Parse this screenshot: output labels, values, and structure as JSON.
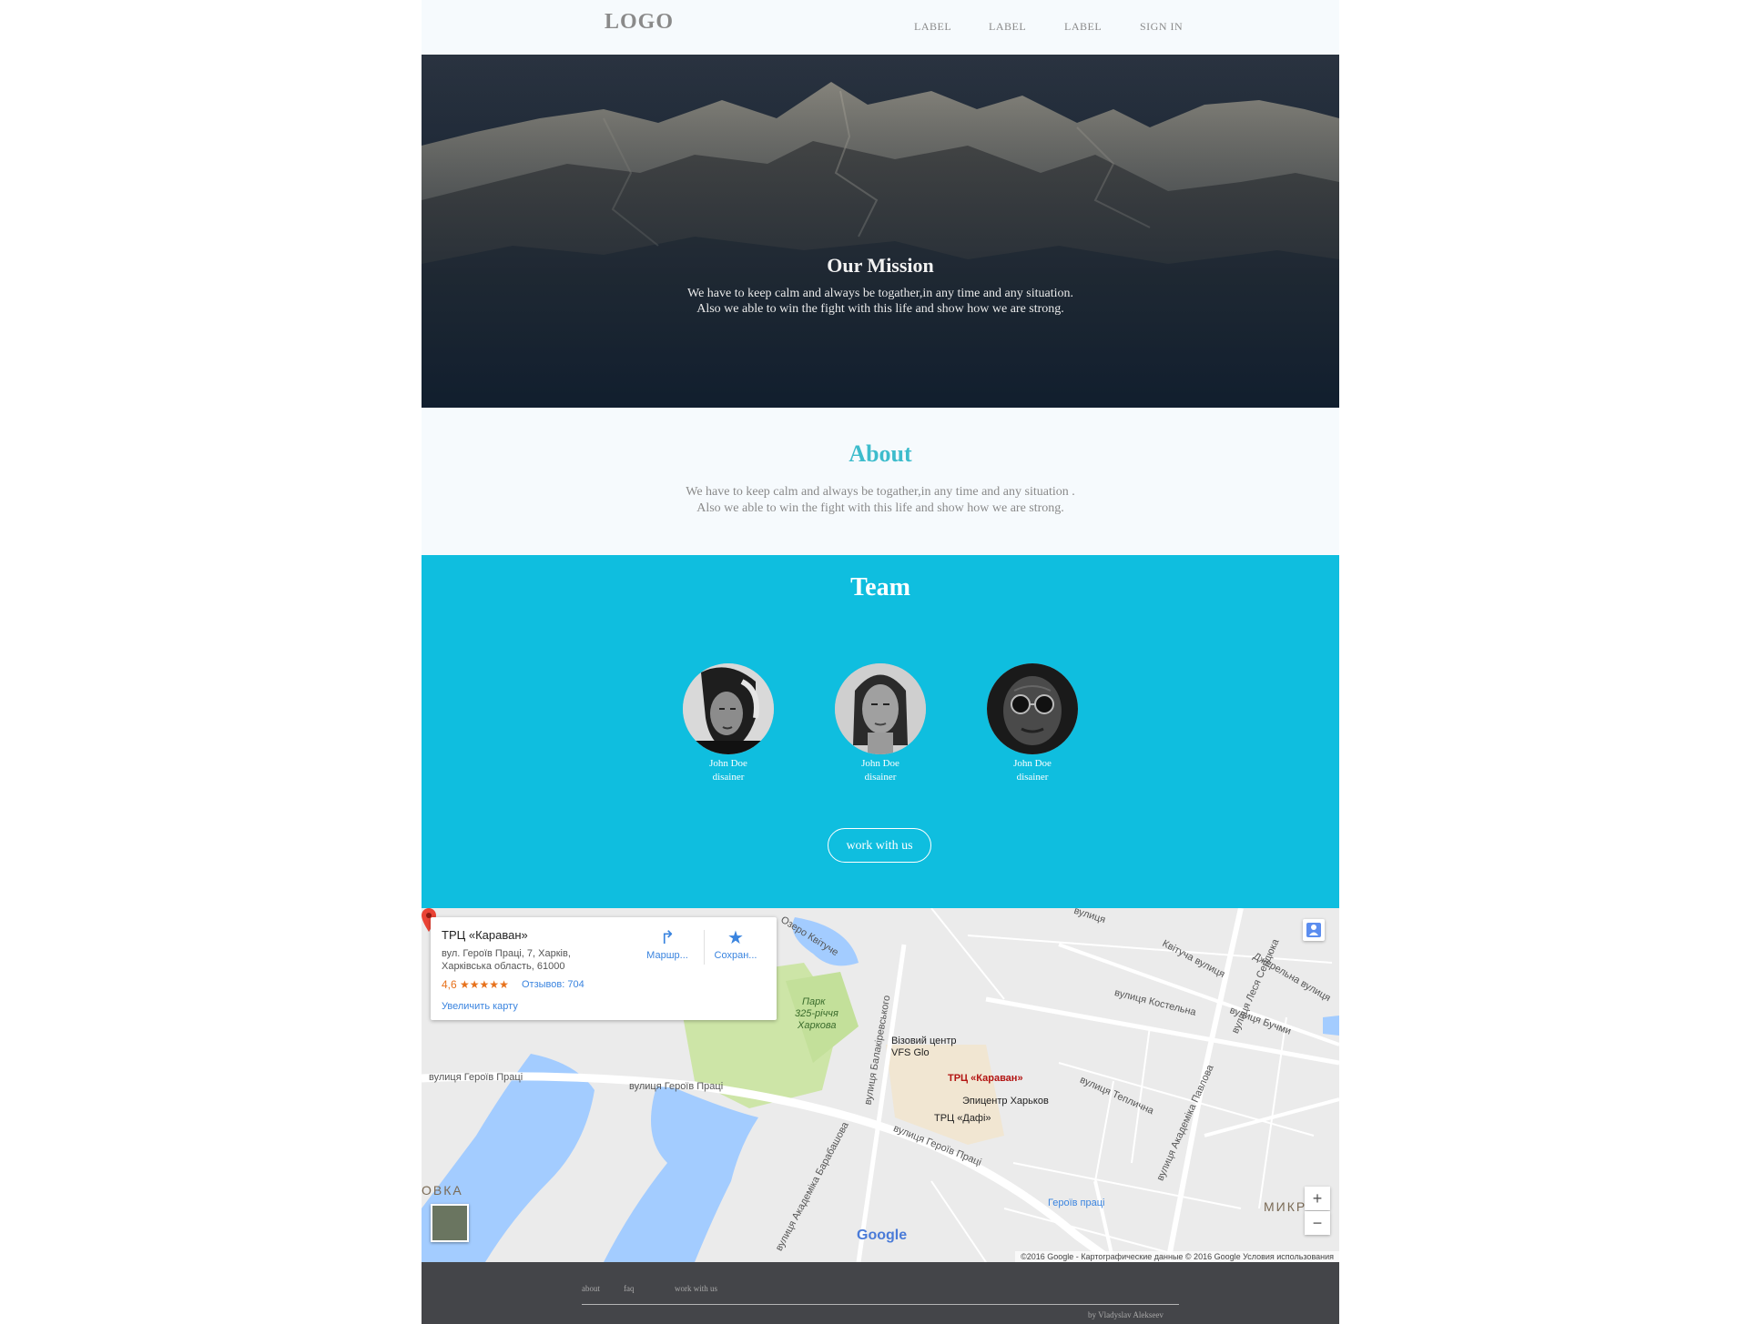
{
  "header": {
    "logo": "LOGO",
    "nav": [
      "LABEL",
      "LABEL",
      "LABEL",
      "SIGN IN"
    ]
  },
  "hero": {
    "title": "Our Mission",
    "line1": "We have to keep calm and always be togather,in any time and any situation.",
    "line2": "Also we able to win the fight with this life and show how we are strong."
  },
  "about": {
    "title": "About",
    "line1": "We have to keep calm and always be togather,in any time and any situation .",
    "line2": "Also we able to win the fight with this life and show how we are strong."
  },
  "team": {
    "title": "Team",
    "members": [
      {
        "name": "John Doe",
        "role": "disainer"
      },
      {
        "name": "John Doe",
        "role": "disainer"
      },
      {
        "name": "John Doe",
        "role": "disainer"
      }
    ],
    "button": "work with us"
  },
  "map": {
    "place_name": "ТРЦ «Караван»",
    "address_line1": "вул. Героїв Праці, 7, Харків,",
    "address_line2": "Харківська область, 61000",
    "rating": "4,6",
    "stars": "★★★★★",
    "reviews": "Отзывов: 704",
    "enlarge": "Увеличить карту",
    "directions": "Маршр...",
    "save": "Сохран...",
    "marker_label": "ТРЦ «Караван»",
    "labels": {
      "park1": "Парк",
      "park2": "325-річчя",
      "park3": "Харкова",
      "visa1": "Візовий центр",
      "visa2": "VFS Glo",
      "epicenter": "Эпицентр Харьков",
      "dafi": "ТРЦ «Дафі»",
      "heroiv_pratsi_metro": "Героїв праці",
      "street_heroiv1": "вулиця Героїв Праці",
      "street_heroiv2": "вулиця Героїв Праці",
      "street_heroiv3": "вулиця Героїв Праці",
      "street_kostelna": "вулиця Костельна",
      "street_kvitucha": "Квітуча вулиця",
      "street_buchmy": "вулиця Бучми",
      "street_dzherelna": "Джерельна вулиця",
      "street_teplychna": "вулиця Теплична",
      "street_pavlova": "вулиця Академіка Павлова",
      "street_barabashova": "вулиця Академіка Барабашова",
      "street_balakirevskoho": "вулиця Балакіревського",
      "street_lesya": "вулиця Леся Сердюка",
      "street_vulytsia": "вулиця",
      "ozero": "Озеро Квітуче",
      "ovka": "ОВКА",
      "mikro": "МИКР"
    },
    "google": "Google",
    "attribution": "©2016 Google - Картографические данные © 2016 Google    Условия использования",
    "zoom_in": "+",
    "zoom_out": "−"
  },
  "footer": {
    "links": [
      "about",
      "faq",
      "work with us"
    ],
    "credit": "by Vladyslav Alekseev"
  },
  "colors": {
    "accent_team": "#0fbedf",
    "about_title": "#3dbccc",
    "footer_bg": "#444549",
    "page_bg": "#f6fafd"
  }
}
